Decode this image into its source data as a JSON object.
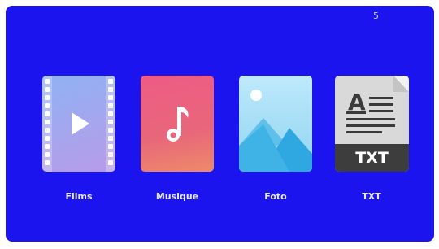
{
  "status": {
    "corner_indicator": "5"
  },
  "menu": {
    "items": [
      {
        "label": "Films",
        "icon": "film-play-icon"
      },
      {
        "label": "Musique",
        "icon": "music-note-icon"
      },
      {
        "label": "Foto",
        "icon": "photo-landscape-icon"
      },
      {
        "label": "TXT",
        "icon": "text-document-icon",
        "badge": "TXT",
        "glyph": "A"
      }
    ]
  },
  "colors": {
    "background": "#1c14ee",
    "label": "#e8ebff"
  }
}
